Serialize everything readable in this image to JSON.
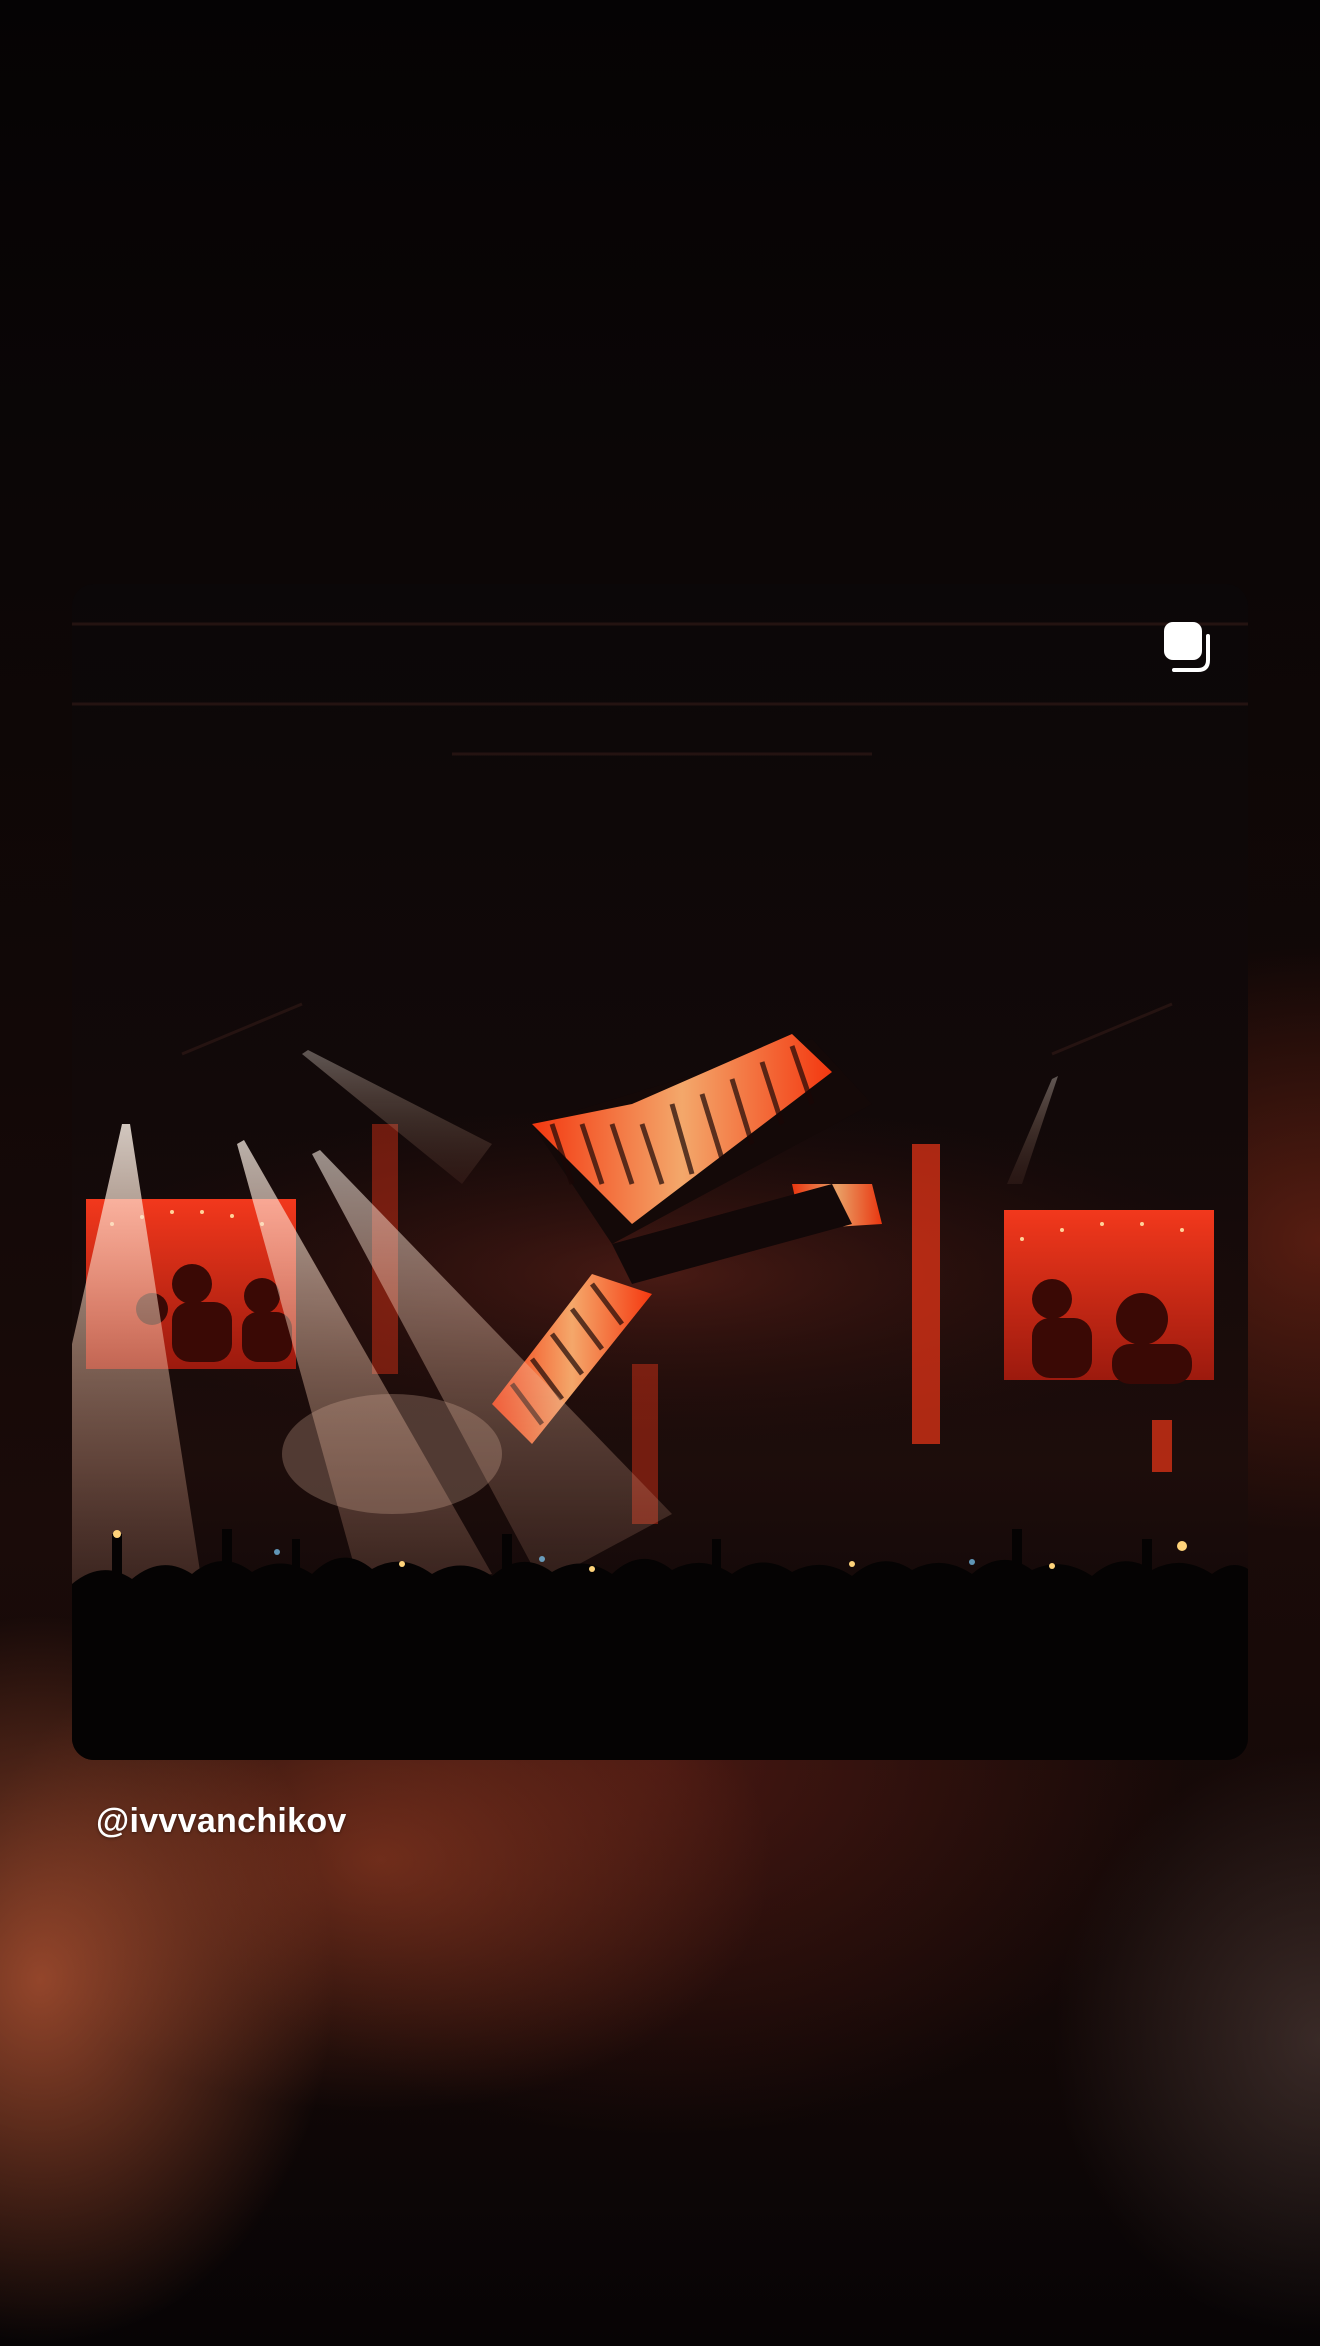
{
  "post": {
    "username": "@ivvvanchikov",
    "media_type_icon": "multiple-photos-icon"
  },
  "colors": {
    "accent_orange": "#ff5a1e",
    "screen_red": "#e8321c",
    "spotlight": "#ffe6d2"
  }
}
